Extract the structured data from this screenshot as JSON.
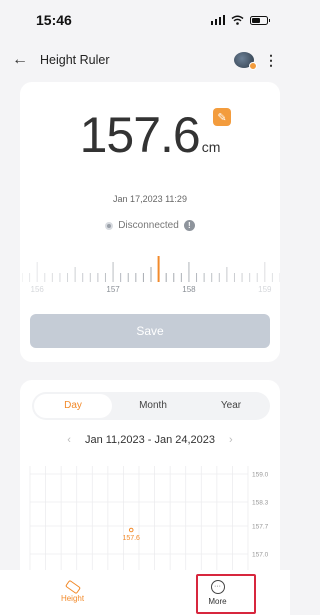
{
  "status_bar": {
    "time": "15:46"
  },
  "header": {
    "title": "Height Ruler",
    "back_icon": "arrow-left-icon",
    "menu_icon": "more-vertical-icon"
  },
  "measurement": {
    "value": "157.6",
    "unit": "cm",
    "timestamp": "Jan 17,2023 11:29",
    "connection_status": "Disconnected"
  },
  "ruler": {
    "labels": [
      "156",
      "157",
      "158",
      "159"
    ],
    "current": 157.6,
    "min": 155.8,
    "max": 159.2
  },
  "save_button": {
    "label": "Save"
  },
  "history": {
    "tabs": [
      {
        "label": "Day",
        "active": true
      },
      {
        "label": "Month",
        "active": false
      },
      {
        "label": "Year",
        "active": false
      }
    ],
    "date_range": "Jan 11,2023 - Jan 24,2023"
  },
  "chart_data": {
    "type": "scatter",
    "y_ticks": [
      "159.0",
      "158.3",
      "157.7",
      "157.0"
    ],
    "ylim": [
      156.6,
      159.2
    ],
    "columns": 14,
    "points": [
      {
        "index": 6,
        "value": 157.6,
        "label": "157.6"
      }
    ]
  },
  "bottom_nav": {
    "items": [
      {
        "label": "Height",
        "icon": "ruler-icon",
        "active": true
      },
      {
        "label": "More",
        "icon": "more-circle-icon",
        "active": false
      }
    ]
  },
  "colors": {
    "accent": "#f28a2a",
    "highlight": "#d7263d",
    "save_disabled": "#c5ccd6"
  }
}
